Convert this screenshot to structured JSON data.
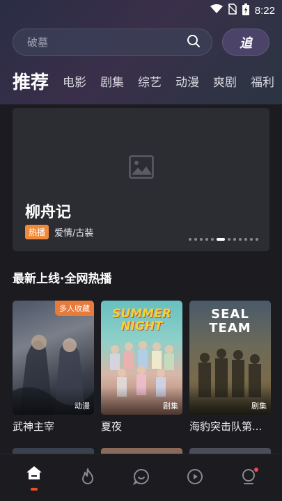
{
  "status": {
    "time": "8:22"
  },
  "search": {
    "placeholder": "破墓"
  },
  "follow_button": {
    "label": "追"
  },
  "tabs": [
    {
      "label": "推荐",
      "active": true
    },
    {
      "label": "电影"
    },
    {
      "label": "剧集"
    },
    {
      "label": "综艺"
    },
    {
      "label": "动漫"
    },
    {
      "label": "爽剧"
    },
    {
      "label": "福利"
    }
  ],
  "banner": {
    "title": "柳舟记",
    "badge": "热播",
    "genre": "爱情/古装",
    "pagination": {
      "total": 12,
      "current": 6
    }
  },
  "section": {
    "title": "最新上线·全网热播"
  },
  "cards": [
    {
      "name": "武神主宰",
      "type": "动漫",
      "corner_tag": "多人收藏",
      "poster_text": ""
    },
    {
      "name": "夏夜",
      "type": "剧集",
      "corner_tag": "",
      "poster_text": "SUMMER NIGHT"
    },
    {
      "name": "海豹突击队第...",
      "type": "剧集",
      "corner_tag": "",
      "poster_text": "SEAL TEAM"
    }
  ],
  "colors": {
    "accent": "#f04a2a",
    "hot_badge": "#f08a3a",
    "corner_tag": "#e87a3a",
    "background": "#1b1b20"
  },
  "nav": [
    {
      "icon": "home-icon",
      "active": true
    },
    {
      "icon": "fire-icon"
    },
    {
      "icon": "chat-icon"
    },
    {
      "icon": "play-icon"
    },
    {
      "icon": "profile-icon",
      "badge": true
    }
  ]
}
